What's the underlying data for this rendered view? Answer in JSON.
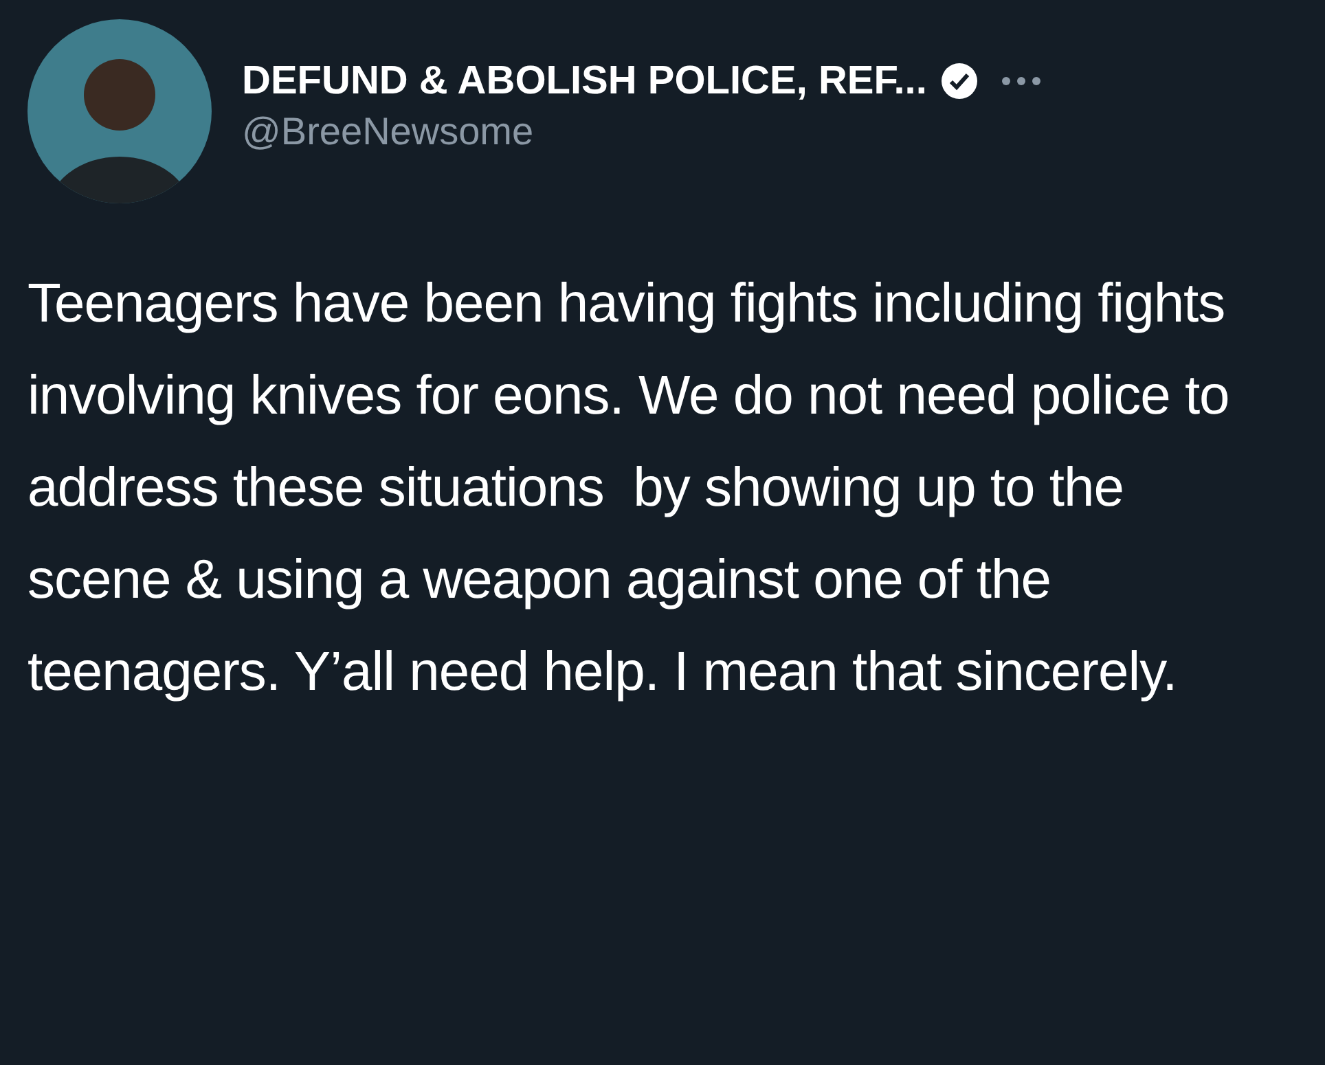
{
  "tweet": {
    "author": {
      "name": "DEFUND & ABOLISH POLICE, REF...",
      "handle": "@BreeNewsome",
      "verified": true
    },
    "text": "Teenagers have been having fights including fights involving knives for eons. We do not need police to address these situations  by showing up to the scene & using a weapon against one of the teenagers. Y’all need help. I mean that sincerely."
  }
}
